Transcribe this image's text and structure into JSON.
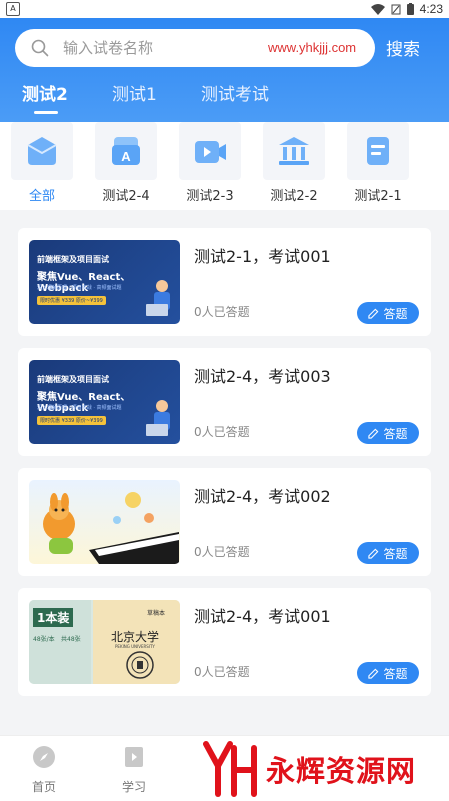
{
  "status_bar": {
    "time": "4:23",
    "left_label": "A"
  },
  "search": {
    "placeholder": "输入试卷名称",
    "button_label": "搜索"
  },
  "tabs": [
    {
      "label": "测试2",
      "active": true
    },
    {
      "label": "测试1",
      "active": false
    },
    {
      "label": "测试考试",
      "active": false
    }
  ],
  "categories": [
    {
      "label": "全部",
      "icon": "box-icon",
      "active": true
    },
    {
      "label": "测试2-4",
      "icon": "letter-a-icon",
      "active": false
    },
    {
      "label": "测试2-3",
      "icon": "video-camera-icon",
      "active": false
    },
    {
      "label": "测试2-2",
      "icon": "bank-icon",
      "active": false
    },
    {
      "label": "测试2-1",
      "icon": "document-icon",
      "active": false
    }
  ],
  "cards": [
    {
      "title": "测试2-1，考试001",
      "count": "0人已答题",
      "button": "答题",
      "thumb": {
        "type": "course-banner",
        "line1": "前端框架及项目面试",
        "line2": "聚焦Vue、React、Webpack",
        "line3": "深入理解原理 · 项目实战 · 高频面试题",
        "tag": "限时优惠 ¥339 原价~¥399"
      }
    },
    {
      "title": "测试2-4，考试003",
      "count": "0人已答题",
      "button": "答题",
      "thumb": {
        "type": "course-banner",
        "line1": "前端框架及项目面试",
        "line2": "聚焦Vue、React、Webpack",
        "line3": "深入理解原理 · 项目实战 · 高频面试题",
        "tag": "限时优惠 ¥339 原价~¥399"
      }
    },
    {
      "title": "测试2-4，考试002",
      "count": "0人已答题",
      "button": "答题",
      "thumb": {
        "type": "cartoon-music"
      }
    },
    {
      "title": "测试2-4，考试001",
      "count": "0人已答题",
      "button": "答题",
      "thumb": {
        "type": "notebook",
        "label": "1本装",
        "sub1": "48张/本",
        "sub2": "共48张",
        "school": "北京大学",
        "school_en": "PEKING UNIVERSITY",
        "mark": "草稿本"
      }
    }
  ],
  "bottom_nav": [
    {
      "label": "首页",
      "icon": "compass-icon"
    },
    {
      "label": "学习",
      "icon": "book-play-icon"
    }
  ],
  "watermark": {
    "text": "永辉资源网",
    "url": "www.yhkjjj.com"
  },
  "colors": {
    "primary": "#2f88f3",
    "watermark_red": "#e0121b"
  }
}
